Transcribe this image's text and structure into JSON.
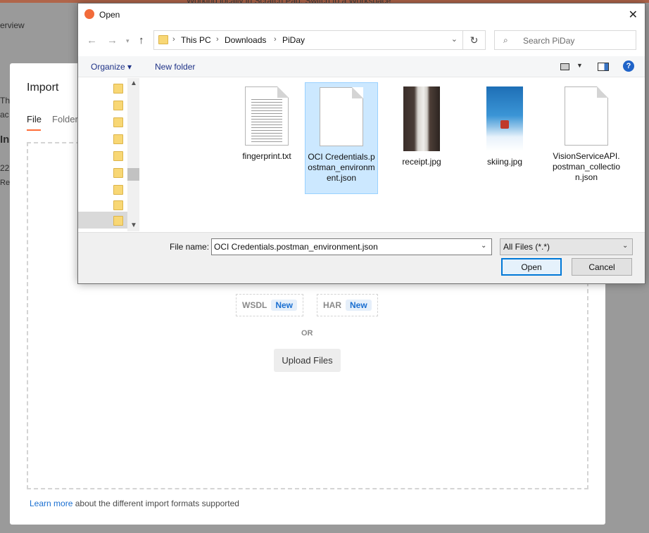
{
  "background": {
    "banner_text": "Working locally in Scratch Pad. Switch to a Workspace",
    "overview_tab": "erview",
    "side_fragments": [
      {
        "text": "Th"
      },
      {
        "text": "ac"
      },
      {
        "text": "In"
      },
      {
        "text": "22"
      },
      {
        "text": "Re"
      }
    ]
  },
  "import_modal": {
    "title": "Import",
    "tabs": [
      {
        "label": "File",
        "active": true
      },
      {
        "label": "Folder",
        "active": false
      }
    ],
    "formats": [
      {
        "label": "WSDL",
        "badge": "New"
      },
      {
        "label": "HAR",
        "badge": "New"
      }
    ],
    "or_label": "OR",
    "upload_button": "Upload Files",
    "learn_more_link": "Learn more",
    "learn_more_text": "about the different import formats supported",
    "accent_color": "#ff6c37"
  },
  "dialog": {
    "title": "Open",
    "app_icon": "postman-logo-icon",
    "breadcrumbs": [
      "This PC",
      "Downloads",
      "PiDay"
    ],
    "search_placeholder": "Search PiDay",
    "toolbar": {
      "organize": "Organize",
      "new_folder": "New folder"
    },
    "files": [
      {
        "name": "fingerprint.txt",
        "kind": "text-document-icon",
        "selected": false
      },
      {
        "name": "OCI Credentials.postman_environment.json",
        "kind": "json-document-icon",
        "selected": true
      },
      {
        "name": "receipt.jpg",
        "kind": "image-thumbnail",
        "selected": false
      },
      {
        "name": "skiing.jpg",
        "kind": "image-thumbnail",
        "selected": false
      },
      {
        "name": "VisionServiceAPI.postman_collection.json",
        "kind": "json-document-icon",
        "selected": false
      }
    ],
    "file_name_label": "File name:",
    "file_name_value": "OCI Credentials.postman_environment.json",
    "file_type_filter": "All Files (*.*)",
    "open_button": "Open",
    "cancel_button": "Cancel",
    "selection_color": "#cce8ff"
  }
}
